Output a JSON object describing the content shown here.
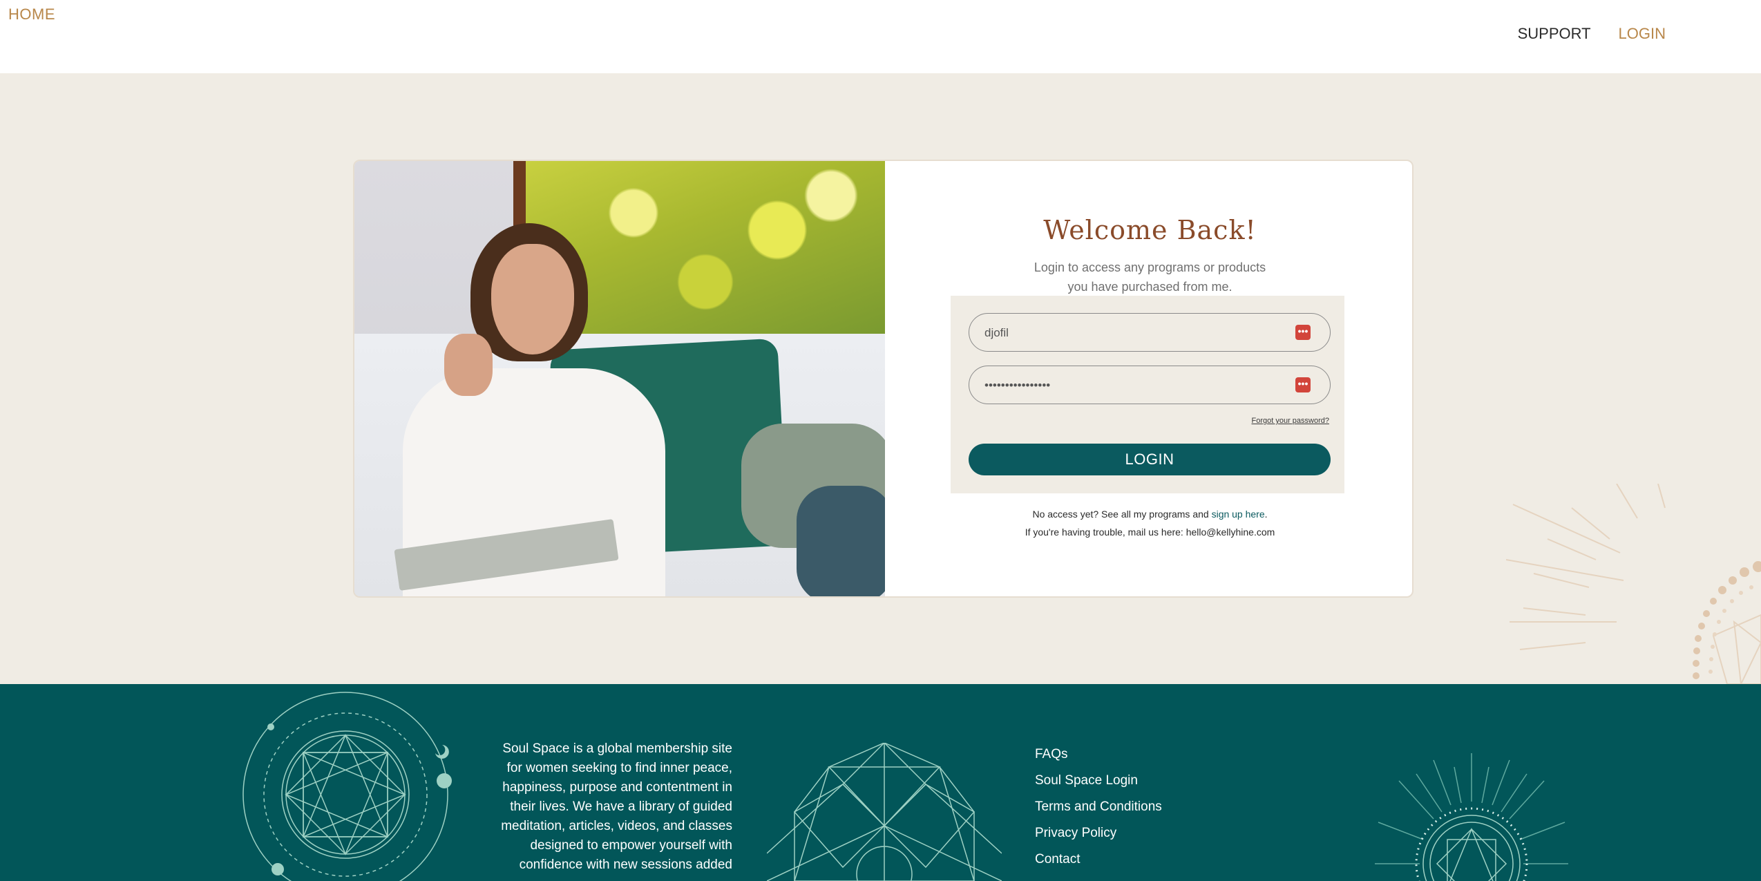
{
  "nav": {
    "home_label": "HOME",
    "support_label": "SUPPORT",
    "login_label": "LOGIN"
  },
  "login": {
    "title": "Welcome Back!",
    "subtitle_line1": "Login to access any programs or products",
    "subtitle_line2": "you have purchased from me.",
    "username_value": "djofil",
    "password_value": "••••••••••••••••",
    "forgot_label": "Forgot your password?",
    "button_label": "LOGIN",
    "no_access_prefix": "No access yet? See all my programs and ",
    "signup_link": "sign up here",
    "no_access_suffix": ".",
    "trouble_text": "If you're having trouble, mail us here: hello@kellyhine.com"
  },
  "footer": {
    "about_text": "Soul Space is a global membership site for women seeking to find inner peace, happiness, purpose and contentment in their lives. We have a library of guided meditation, articles, videos, and classes designed to empower yourself with confidence with new sessions added",
    "links": [
      {
        "label": "FAQs"
      },
      {
        "label": "Soul Space Login"
      },
      {
        "label": "Terms and Conditions"
      },
      {
        "label": "Privacy Policy"
      },
      {
        "label": "Contact"
      }
    ]
  },
  "colors": {
    "accent_gold": "#b8874a",
    "title_brown": "#8a4b2a",
    "teal": "#0b5a5f",
    "footer_teal": "#025659",
    "page_bg": "#f0ece4",
    "password_manager_icon": "#d2453b"
  }
}
